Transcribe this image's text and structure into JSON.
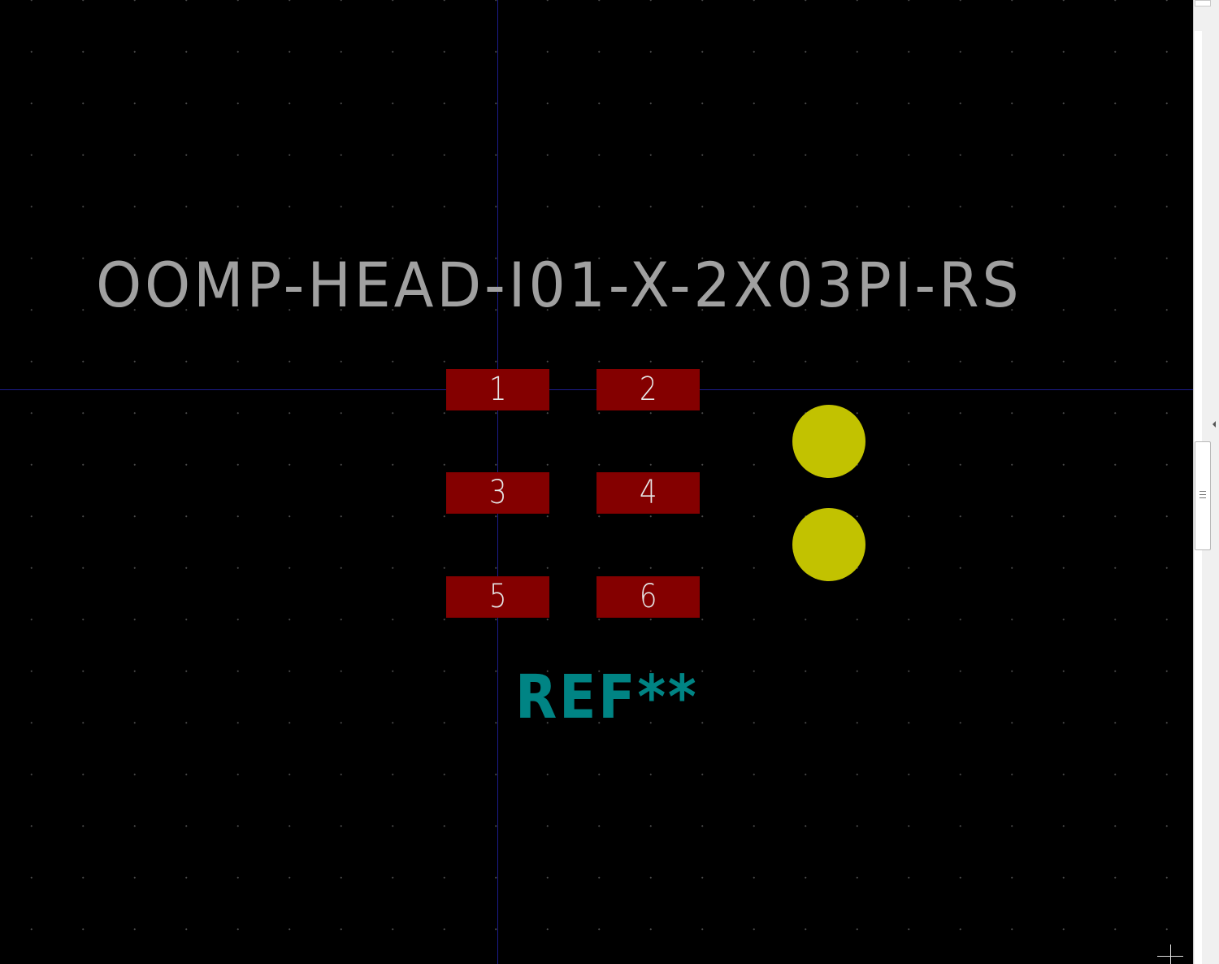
{
  "footprint": {
    "value_text": "OOMP-HEAD-I01-X-2X03PI-RS",
    "reference_text": "REF**"
  },
  "pads": [
    {
      "number": "1"
    },
    {
      "number": "2"
    },
    {
      "number": "3"
    },
    {
      "number": "4"
    },
    {
      "number": "5"
    },
    {
      "number": "6"
    }
  ],
  "mounting_holes": 2,
  "colors": {
    "background": "#000000",
    "grid_dot": "#4a4a4a",
    "axis": "#1c1c8c",
    "value_text": "#a0a0a0",
    "reference_text": "#008484",
    "pad": "#840000",
    "pad_label": "#e6e6e6",
    "hole": "#c2c200"
  },
  "icons": {
    "cursor": "crosshair-icon",
    "scroll_grip": "grip-icon"
  }
}
